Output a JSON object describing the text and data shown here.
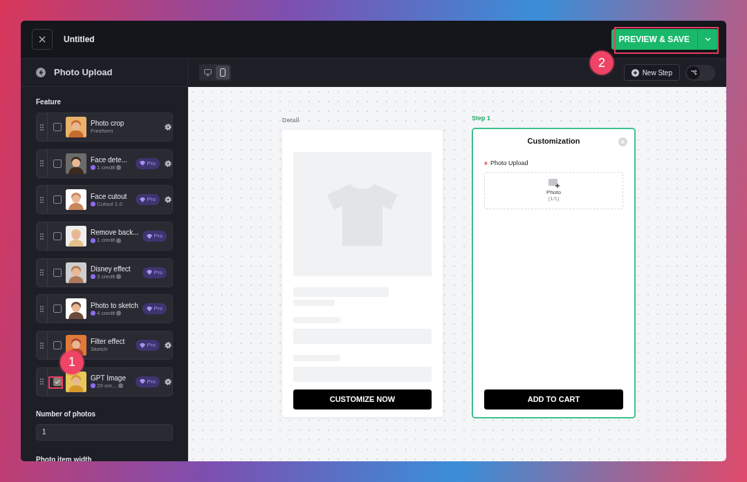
{
  "header": {
    "title": "Untitled",
    "save_button": {
      "label": "PREVIEW & SAVE",
      "highlighted": true
    },
    "callout": "2"
  },
  "sidebar": {
    "title": "Photo Upload",
    "section": "Feature",
    "features": [
      {
        "name": "Photo crop",
        "subtitle": "Freeform",
        "kind": "plain",
        "settings": true,
        "checked": false,
        "highlighted": false
      },
      {
        "name": "Face dete...",
        "subtitle": "1 credit",
        "kind": "credit",
        "badge": "Pro",
        "settings": true,
        "checked": false,
        "highlighted": false
      },
      {
        "name": "Face cutout",
        "subtitle": "Cutout 1.0",
        "kind": "version",
        "badge": "Pro",
        "settings": true,
        "checked": false,
        "highlighted": false
      },
      {
        "name": "Remove back...",
        "subtitle": "1 credit",
        "kind": "credit",
        "badge": "Pro",
        "settings": false,
        "checked": false,
        "highlighted": false
      },
      {
        "name": "Disney effect",
        "subtitle": "3 credit",
        "kind": "credit",
        "badge": "Pro",
        "settings": false,
        "checked": false,
        "highlighted": false
      },
      {
        "name": "Photo to sketch",
        "subtitle": "4 credit",
        "kind": "credit",
        "badge": "Pro",
        "settings": false,
        "checked": false,
        "highlighted": false
      },
      {
        "name": "Filter effect",
        "subtitle": "Sketch",
        "kind": "plain",
        "badge": "Pro",
        "settings": true,
        "checked": false,
        "highlighted": false
      },
      {
        "name": "GPT Image",
        "subtitle": "20 cre...",
        "kind": "credit",
        "badge": "Pro",
        "settings": true,
        "checked": true,
        "highlighted": true,
        "callout": "1"
      }
    ],
    "number_of_photos": {
      "label": "Number of photos",
      "value": "1"
    },
    "photo_item_width": {
      "label": "Photo item width"
    }
  },
  "toolbar": {
    "devices": [
      {
        "kind": "desktop",
        "selected": false
      },
      {
        "kind": "mobile",
        "selected": true
      }
    ],
    "new_step": "New Step",
    "branching_toggle": {
      "on": false
    }
  },
  "canvas": {
    "detail": {
      "label": "Detail",
      "button": "CUSTOMIZE NOW"
    },
    "step": {
      "label": "Step 1",
      "title": "Customization",
      "field_label": "Photo Upload",
      "required": true,
      "upload_label": "Photo",
      "upload_count": "(1/1)",
      "button": "ADD TO CART"
    }
  }
}
